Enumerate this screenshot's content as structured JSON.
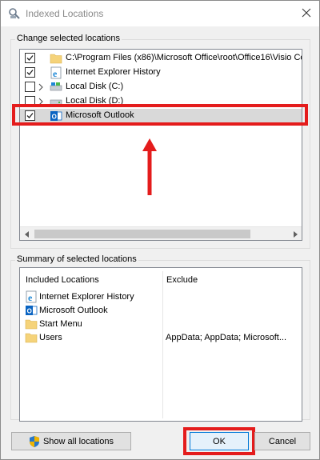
{
  "window": {
    "title": "Indexed Locations",
    "icon": "indexing-options-icon",
    "close_icon": "close-icon"
  },
  "change_group": {
    "label": "Change selected locations",
    "items": [
      {
        "checked": true,
        "expandable": false,
        "icon": "folder-icon",
        "label": "C:\\Program Files (x86)\\Microsoft Office\\root\\Office16\\Visio Co"
      },
      {
        "checked": true,
        "expandable": false,
        "icon": "ie-icon",
        "label": "Internet Explorer History"
      },
      {
        "checked": false,
        "expandable": true,
        "icon": "drive-icon",
        "label": "Local Disk (C:)"
      },
      {
        "checked": false,
        "expandable": true,
        "icon": "drive-icon",
        "label": "Local Disk (D:)"
      },
      {
        "checked": true,
        "expandable": false,
        "icon": "outlook-icon",
        "label": "Microsoft Outlook",
        "selected": true
      }
    ]
  },
  "summary_group": {
    "label": "Summary of selected locations",
    "col_included": "Included Locations",
    "col_exclude": "Exclude",
    "rows": [
      {
        "icon": "ie-icon",
        "label": "Internet Explorer History",
        "exclude": ""
      },
      {
        "icon": "outlook-icon",
        "label": "Microsoft Outlook",
        "exclude": ""
      },
      {
        "icon": "folder-icon",
        "label": "Start Menu",
        "exclude": ""
      },
      {
        "icon": "folder-icon",
        "label": "Users",
        "exclude": "AppData; AppData; Microsoft..."
      }
    ]
  },
  "buttons": {
    "show_all": "Show all locations",
    "ok": "OK",
    "cancel": "Cancel"
  },
  "annotation_color": "#e41c1c"
}
